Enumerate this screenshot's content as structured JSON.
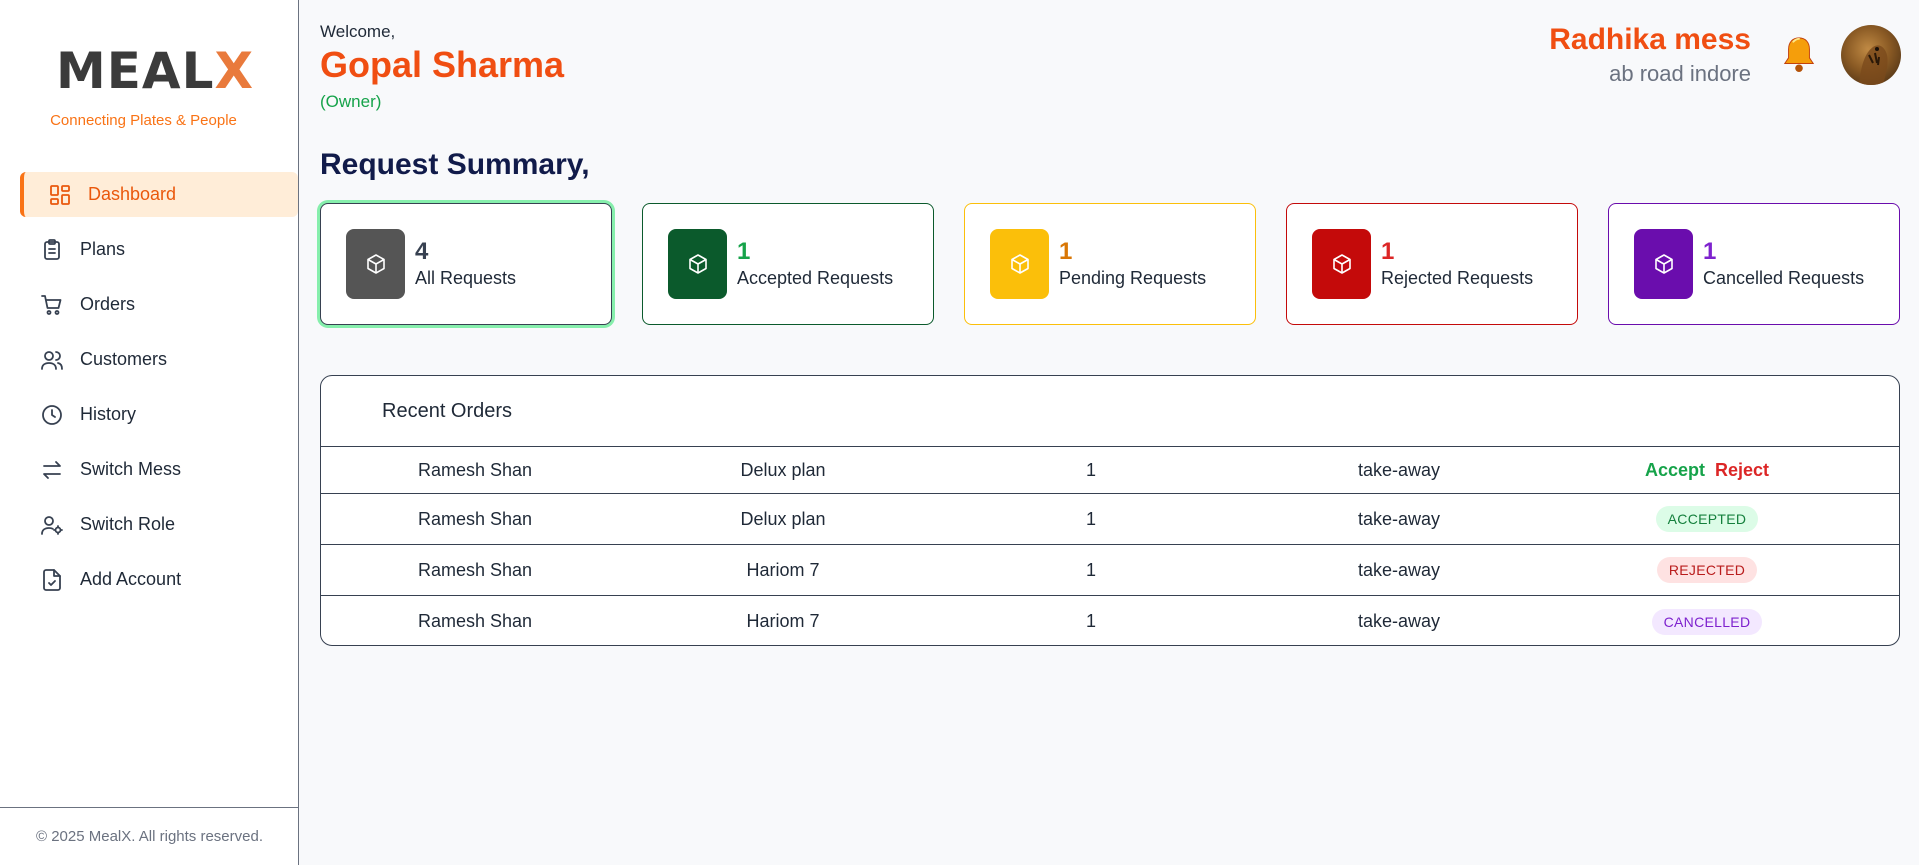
{
  "brand": {
    "logo_main": "MEAL",
    "logo_x": "X",
    "tagline": "Connecting Plates & People"
  },
  "sidebar": {
    "items": [
      {
        "label": "Dashboard",
        "icon": "dashboard-icon",
        "active": true
      },
      {
        "label": "Plans",
        "icon": "clipboard-icon"
      },
      {
        "label": "Orders",
        "icon": "cart-icon"
      },
      {
        "label": "Customers",
        "icon": "users-icon"
      },
      {
        "label": "History",
        "icon": "clock-icon"
      },
      {
        "label": "Switch Mess",
        "icon": "switch-arrows-icon"
      },
      {
        "label": "Switch Role",
        "icon": "user-gear-icon"
      },
      {
        "label": "Add Account",
        "icon": "file-check-icon"
      }
    ],
    "footer": "© 2025 MealX. All rights reserved."
  },
  "header": {
    "welcome": "Welcome,",
    "owner_name": "Gopal Sharma",
    "owner_role": "(Owner)",
    "mess_name": "Radhika mess",
    "mess_address": "ab road indore"
  },
  "summary": {
    "title": "Request Summary,",
    "cards": [
      {
        "count": "4",
        "label": "All Requests",
        "color": "#555555",
        "selected": true
      },
      {
        "count": "1",
        "label": "Accepted Requests",
        "color": "#0b5a2c",
        "count_color": "#16a34a"
      },
      {
        "count": "1",
        "label": "Pending Requests",
        "color": "#fbbf0a",
        "count_color": "#d97706"
      },
      {
        "count": "1",
        "label": "Rejected Requests",
        "color": "#c40a0a",
        "count_color": "#dc2626"
      },
      {
        "count": "1",
        "label": "Cancelled Requests",
        "color": "#6a0dad",
        "count_color": "#7e22ce"
      }
    ]
  },
  "orders": {
    "title": "Recent Orders",
    "rows": [
      {
        "customer": "Ramesh Shan",
        "plan": "Delux plan",
        "qty": "1",
        "type": "take-away",
        "status": "actions",
        "accept_label": "Accept",
        "reject_label": "Reject"
      },
      {
        "customer": "Ramesh Shan",
        "plan": "Delux plan",
        "qty": "1",
        "type": "take-away",
        "status": "ACCEPTED"
      },
      {
        "customer": "Ramesh Shan",
        "plan": "Hariom 7",
        "qty": "1",
        "type": "take-away",
        "status": "REJECTED"
      },
      {
        "customer": "Ramesh Shan",
        "plan": "Hariom 7",
        "qty": "1",
        "type": "take-away",
        "status": "CANCELLED"
      }
    ]
  },
  "colors": {
    "accent": "#f97316",
    "brand_orange": "#f04e12",
    "navy": "#111b4a"
  }
}
